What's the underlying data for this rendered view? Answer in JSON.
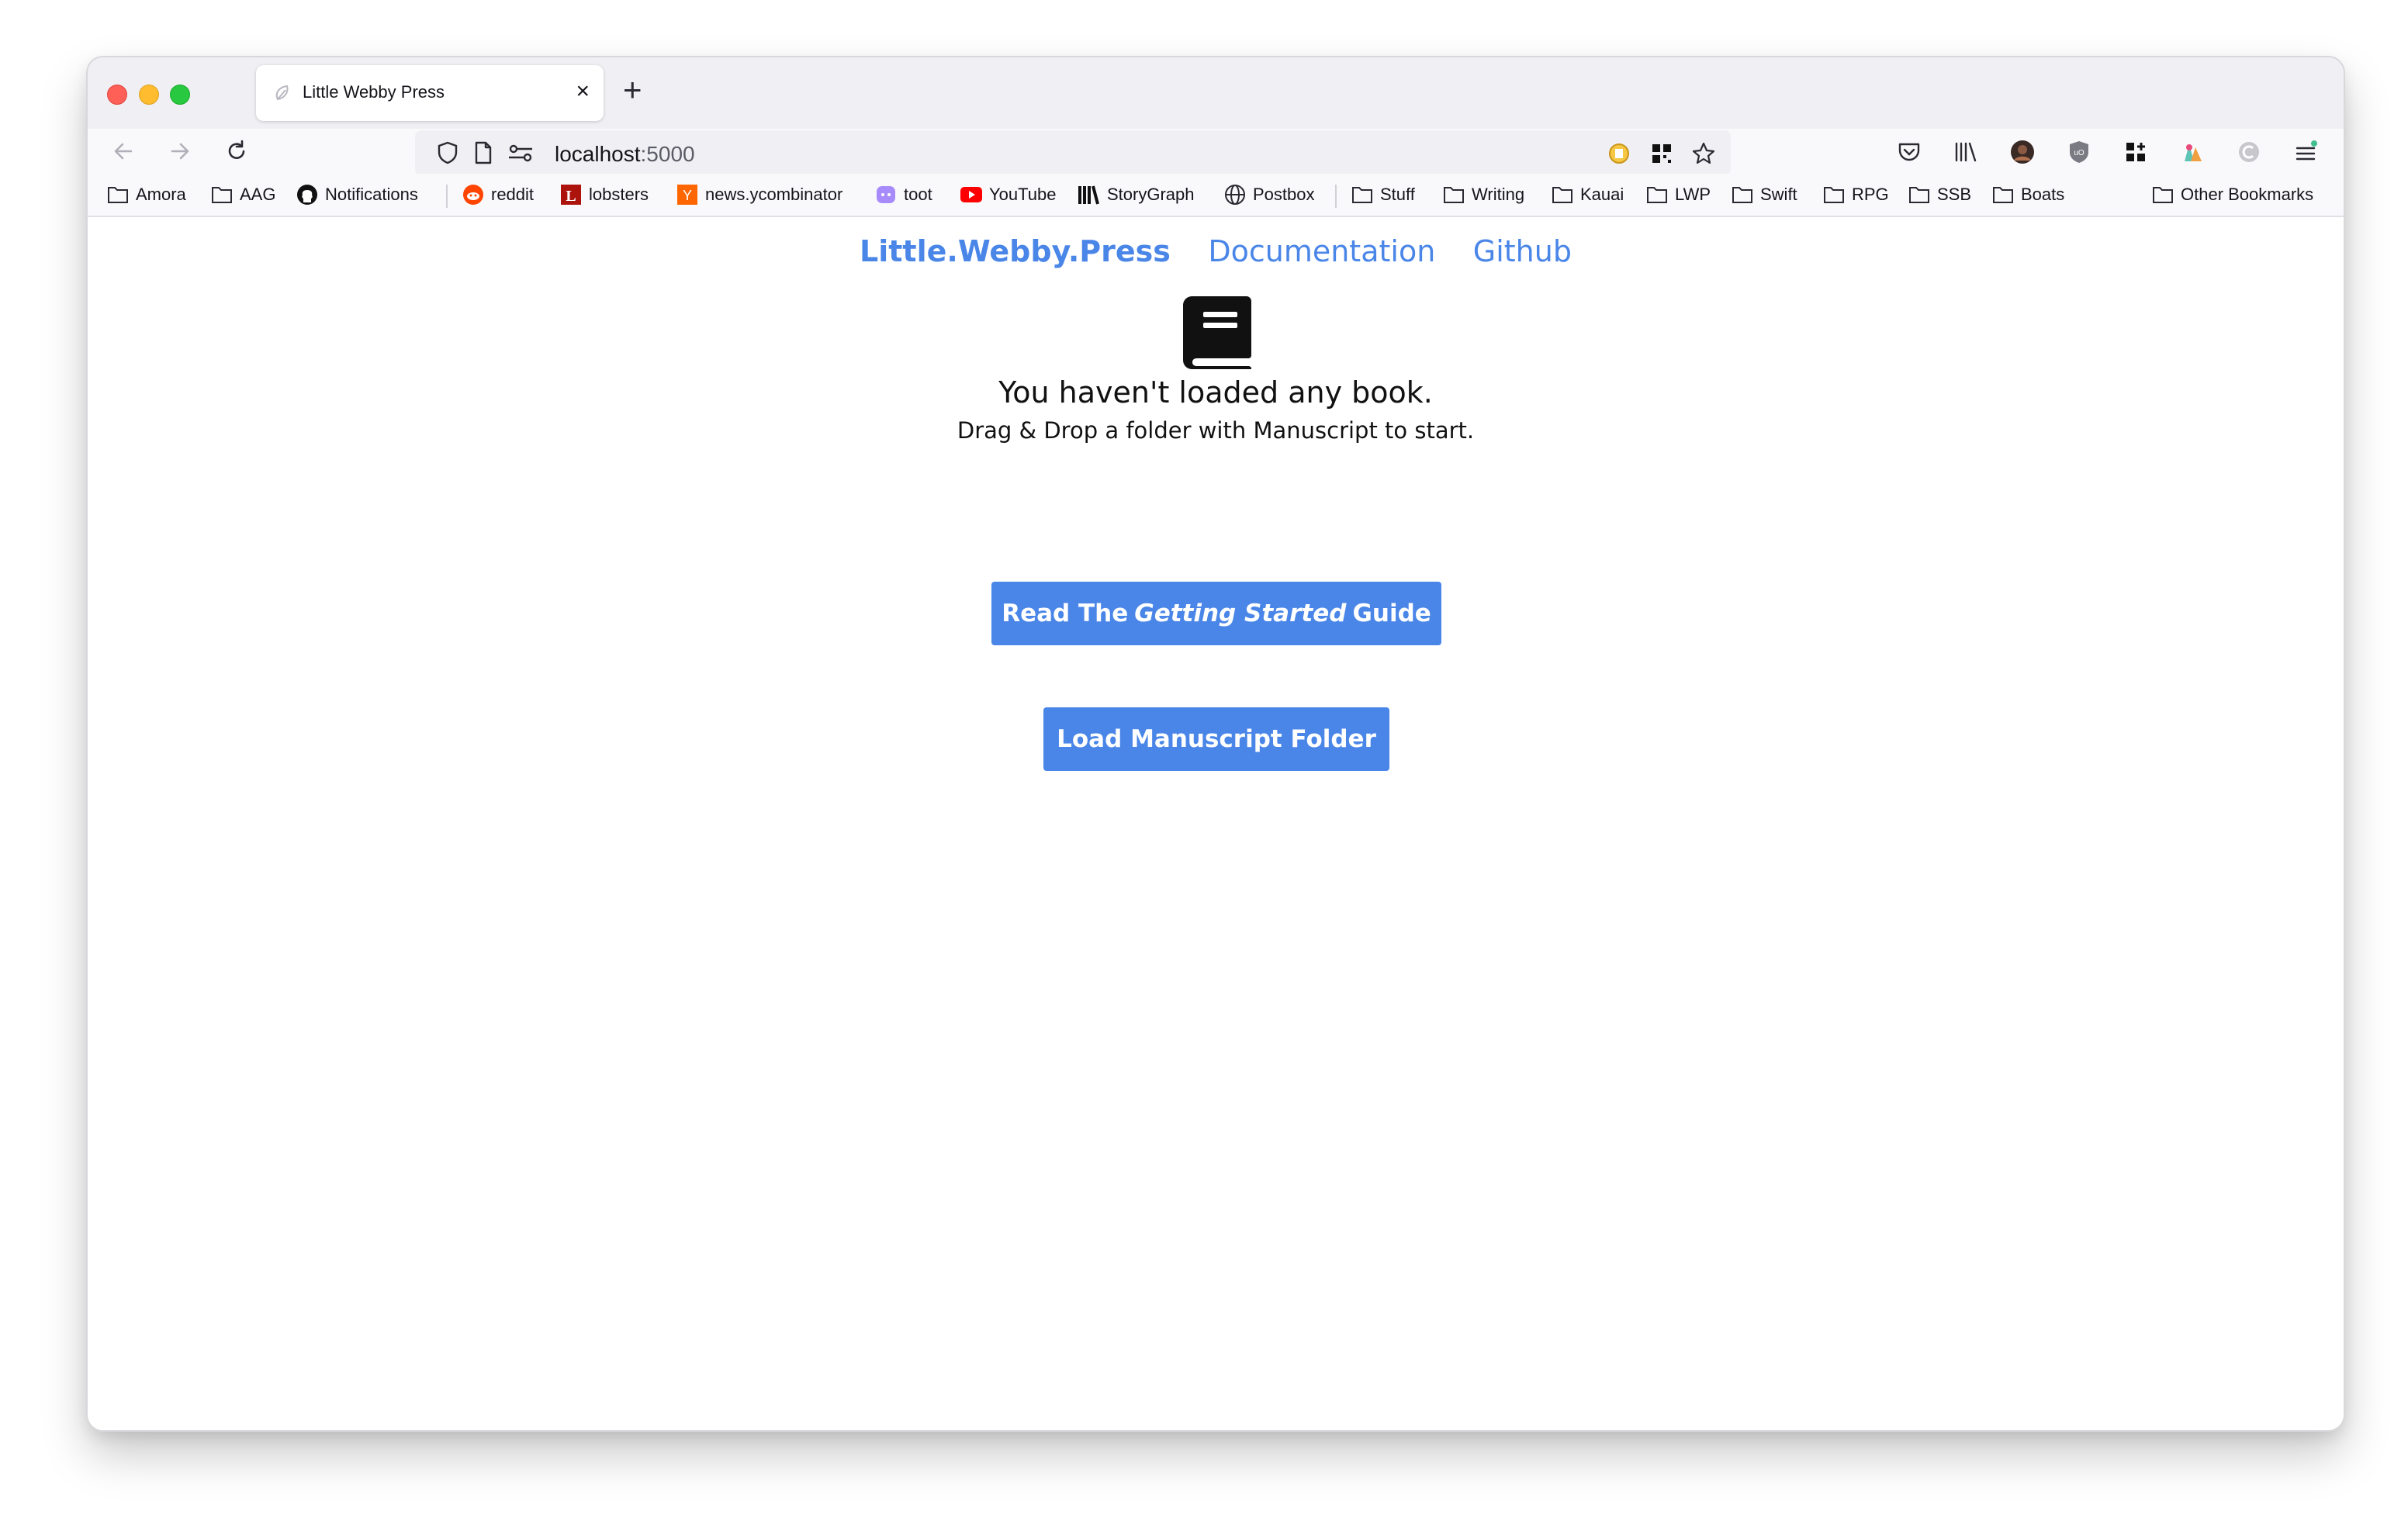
{
  "browser": {
    "tab": {
      "title": "Little Webby Press",
      "close_glyph": "×"
    },
    "new_tab_glyph": "+",
    "url": {
      "host": "localhost",
      "port": ":5000"
    }
  },
  "bookmarks": [
    {
      "label": "Amora",
      "icon": "folder-icon"
    },
    {
      "label": "AAG",
      "icon": "folder-icon"
    },
    {
      "label": "Notifications",
      "icon": "github-icon"
    },
    {
      "label": "reddit",
      "icon": "reddit-icon"
    },
    {
      "label": "lobsters",
      "icon": "lobsters-icon"
    },
    {
      "label": "news.ycombinator",
      "icon": "ycombinator-icon"
    },
    {
      "label": "toot",
      "icon": "mastodon-icon"
    },
    {
      "label": "YouTube",
      "icon": "youtube-icon"
    },
    {
      "label": "StoryGraph",
      "icon": "storygraph-icon"
    },
    {
      "label": "Postbox",
      "icon": "globe-icon"
    },
    {
      "label": "Stuff",
      "icon": "folder-icon"
    },
    {
      "label": "Writing",
      "icon": "folder-icon"
    },
    {
      "label": "Kauai",
      "icon": "folder-icon"
    },
    {
      "label": "LWP",
      "icon": "folder-icon"
    },
    {
      "label": "Swift",
      "icon": "folder-icon"
    },
    {
      "label": "RPG",
      "icon": "folder-icon"
    },
    {
      "label": "SSB",
      "icon": "folder-icon"
    },
    {
      "label": "Boats",
      "icon": "folder-icon"
    },
    {
      "label": "Other Bookmarks",
      "icon": "folder-icon"
    }
  ],
  "page": {
    "nav": {
      "brand": "Little.Webby.Press",
      "docs": "Documentation",
      "github": "Github"
    },
    "headline": "You haven't loaded any book.",
    "subline": "Drag & Drop a folder with Manuscript to start.",
    "guide_button": {
      "prefix": "Read The",
      "emphasis": "Getting Started",
      "suffix": "Guide"
    },
    "load_button": "Load Manuscript Folder"
  },
  "colors": {
    "link": "#4a86e8",
    "button": "#4a86e8"
  }
}
